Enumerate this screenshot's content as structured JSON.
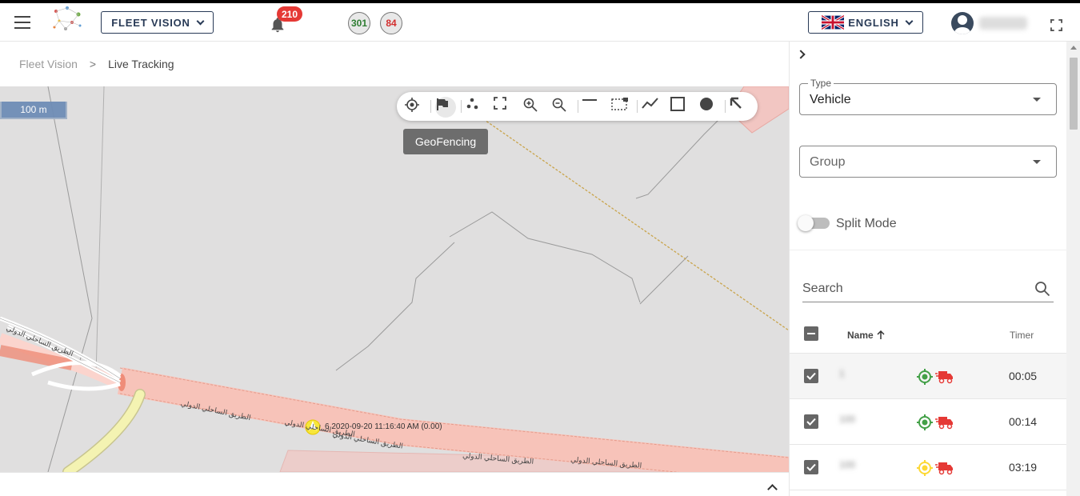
{
  "header": {
    "app_button_label": "FLEET VISION",
    "notifications_count": "210",
    "online_count": "301",
    "offline_count": "84",
    "language_label": "ENGLISH",
    "colors": {
      "brand_navy": "#283a56",
      "badge_red": "#e53935",
      "online_green": "#2e7d32",
      "offline_red": "#d32f2f"
    }
  },
  "breadcrumb": {
    "root": "Fleet Vision",
    "separator": ">",
    "current": "Live Tracking"
  },
  "map": {
    "scale_label": "100 m",
    "tooltip": "GeoFencing",
    "toolbar_icons": [
      "crosshair-icon",
      "flag-icon",
      "cluster-icon",
      "fit-bounds-icon",
      "zoom-in-icon",
      "zoom-out-icon",
      "line-icon",
      "select-area-icon",
      "polyline-icon",
      "square-icon",
      "circle-icon",
      "arrow-cursor-icon"
    ],
    "vehicle_label": "6 2020-09-20 11:16:40 AM (0.00)",
    "road_labels": [
      "الطريق الساحلي الدولي",
      "الطريق الساحلي الدولي",
      "الطريق الساحلي الدولي",
      "الطريق الساحلي الدولي",
      "الطريق الساحلي الدولي",
      "الطريق الساحلي الدولي"
    ]
  },
  "panel": {
    "type_label": "Type",
    "type_value": "Vehicle",
    "group_placeholder": "Group",
    "split_mode_label": "Split Mode",
    "search_placeholder": "Search",
    "columns": {
      "name": "Name",
      "timer": "Timer"
    },
    "rows": [
      {
        "name": "1",
        "status_color": "#43a047",
        "timer": "00:05"
      },
      {
        "name": "100",
        "status_color": "#43a047",
        "timer": "00:14"
      },
      {
        "name": "100",
        "status_color": "#fdd835",
        "timer": "03:19"
      }
    ]
  }
}
